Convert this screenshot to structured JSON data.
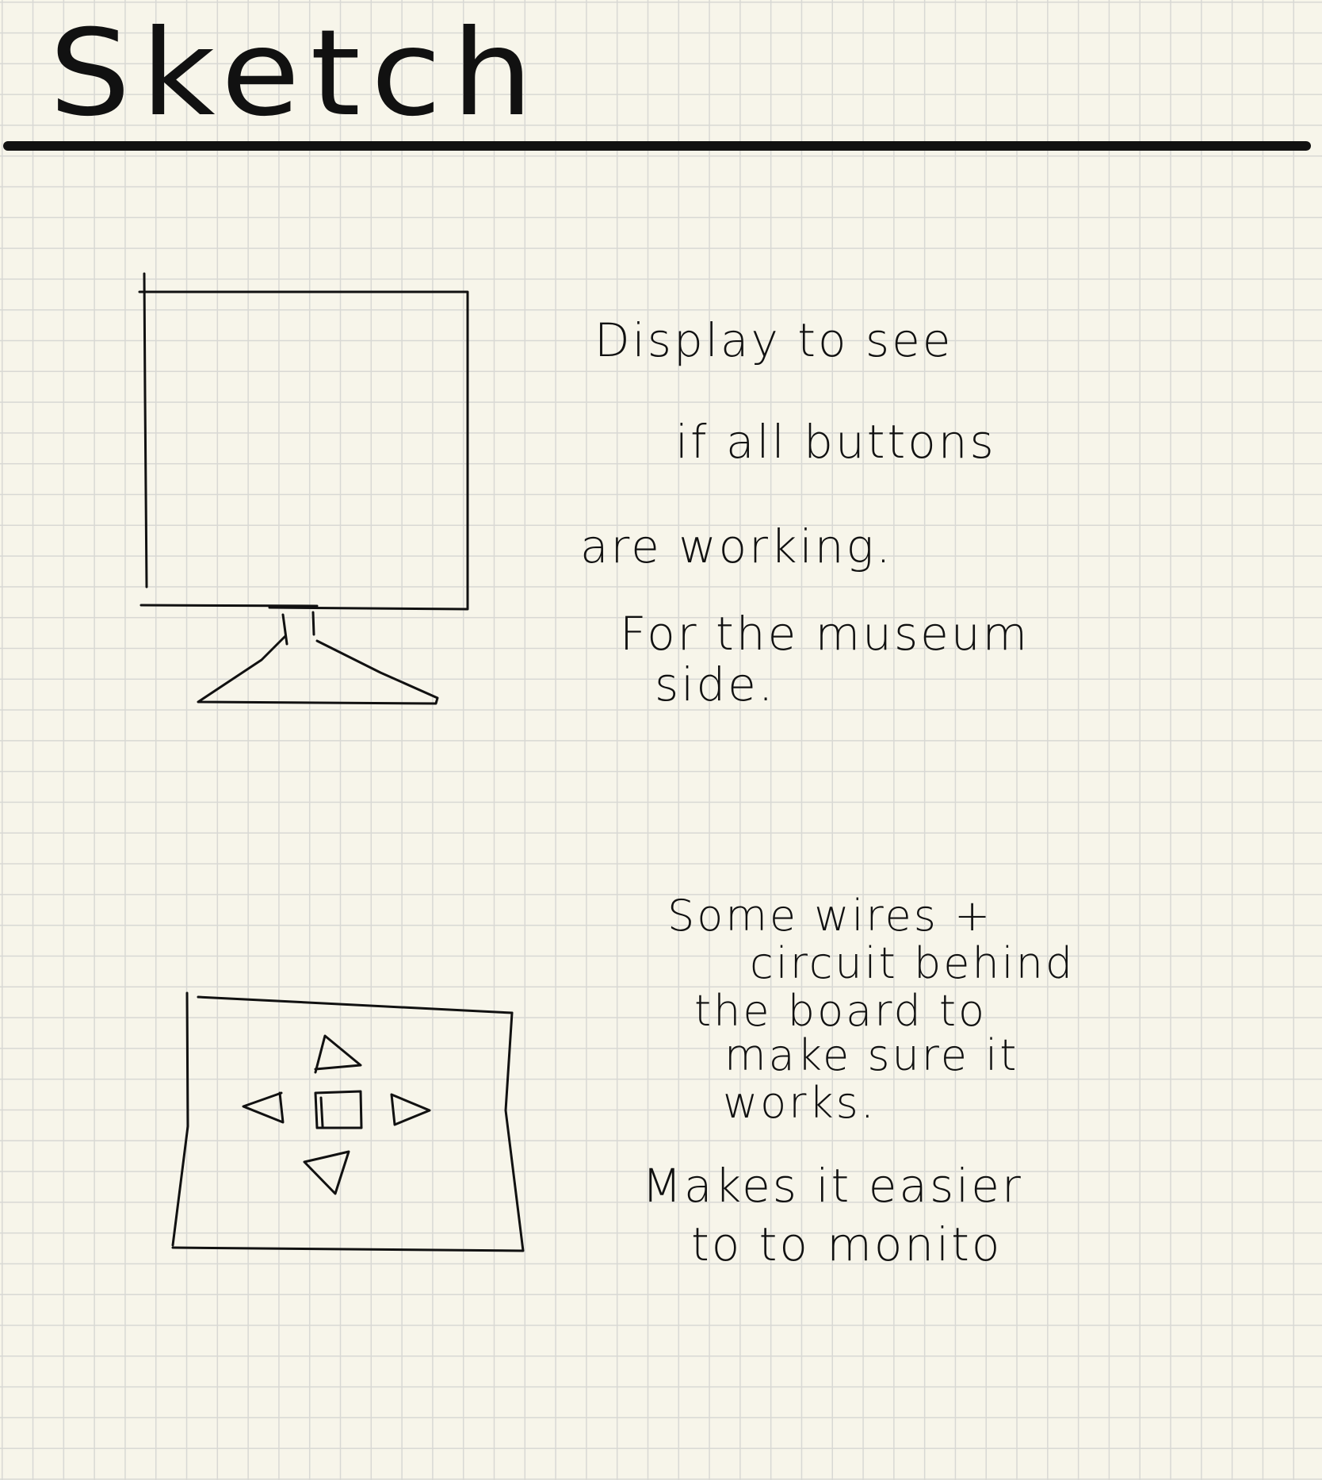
{
  "page": {
    "title": "Sketch"
  },
  "notes": {
    "display": {
      "lines": [
        "Display to see",
        "if all buttons",
        "are working.",
        "For the museum",
        "side."
      ]
    },
    "controller": {
      "lines": [
        "Some wires +",
        "circuit behind",
        "the board to",
        "make sure it",
        "works.",
        "Makes it easier",
        "to to monito"
      ]
    }
  },
  "colors": {
    "ink": "#111111",
    "paper": "#f7f5ea",
    "grid": "#d8d8d4"
  }
}
